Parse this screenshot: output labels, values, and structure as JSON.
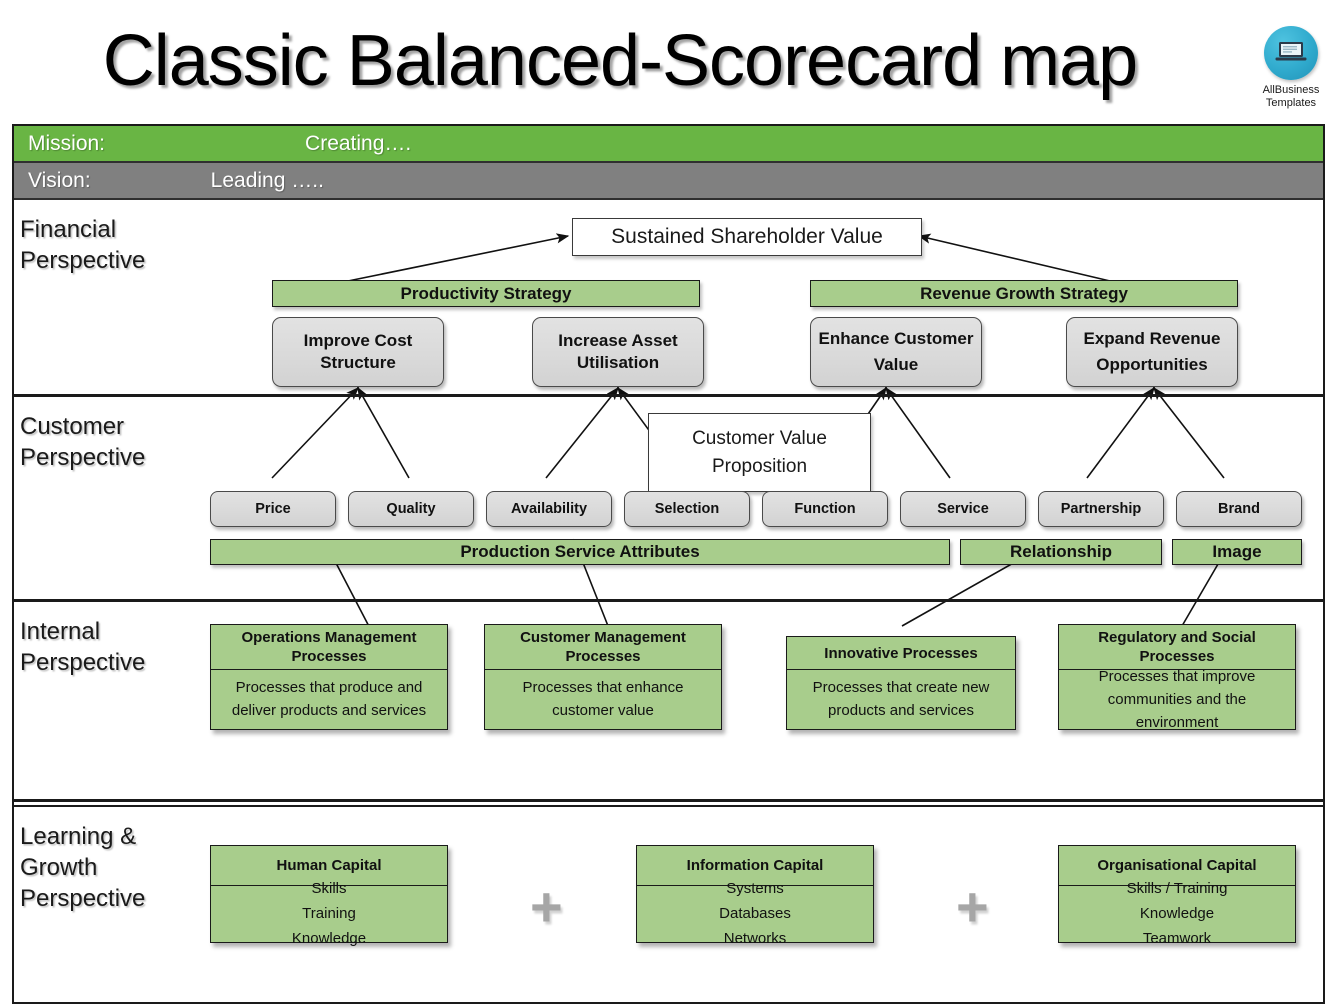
{
  "title": "Classic Balanced-Scorecard map",
  "logo": {
    "line1": "AllBusiness",
    "line2": "Templates",
    "icon": "laptop-icon"
  },
  "banners": {
    "mission": {
      "label": "Mission:",
      "value": "Creating…."
    },
    "vision": {
      "label": "Vision:",
      "value": "Leading ….."
    }
  },
  "colors": {
    "mission_green": "#69b544",
    "vision_gray": "#808080",
    "accent_green": "#a8cd8c",
    "box_gray": "#d9d9d9",
    "plus_gray": "#a6a6a6"
  },
  "perspectives": {
    "financial": {
      "label": "Financial\nPerspective"
    },
    "customer": {
      "label": "Customer\nPerspective"
    },
    "internal": {
      "label": "Internal\nPerspective"
    },
    "learning": {
      "label": "Learning &\nGrowth\nPerspective"
    }
  },
  "financial": {
    "top_objective": "Sustained Shareholder Value",
    "strategies": [
      {
        "name": "Productivity Strategy"
      },
      {
        "name": "Revenue Growth Strategy"
      }
    ],
    "objectives": [
      {
        "name": "Improve Cost Structure"
      },
      {
        "name": "Increase Asset Utilisation"
      },
      {
        "name": "Enhance Customer Value"
      },
      {
        "name": "Expand Revenue Opportunities"
      }
    ]
  },
  "customer": {
    "value_proposition": "Customer Value Proposition",
    "attributes": [
      {
        "name": "Price"
      },
      {
        "name": "Quality"
      },
      {
        "name": "Availability"
      },
      {
        "name": "Selection"
      },
      {
        "name": "Function"
      },
      {
        "name": "Service"
      },
      {
        "name": "Partnership"
      },
      {
        "name": "Brand"
      }
    ],
    "groups": [
      {
        "name": "Production Service Attributes"
      },
      {
        "name": "Relationship"
      },
      {
        "name": "Image"
      }
    ]
  },
  "internal": {
    "processes": [
      {
        "title": "Operations Management Processes",
        "description": "Processes that produce and deliver products and services"
      },
      {
        "title": "Customer Management Processes",
        "description": "Processes that enhance customer value"
      },
      {
        "title": "Innovative Processes",
        "description": "Processes that create new products and services"
      },
      {
        "title": "Regulatory and Social Processes",
        "description": "Processes that improve communities and the environment"
      }
    ]
  },
  "learning": {
    "capitals": [
      {
        "title": "Human Capital",
        "items": "Skills\nTraining\nKnowledge"
      },
      {
        "title": "Information Capital",
        "items": "Systems\nDatabases\nNetworks"
      },
      {
        "title": "Organisational Capital",
        "items": "Skills / Training\nKnowledge\nTeamwork"
      }
    ],
    "separators": [
      "+",
      "+"
    ]
  }
}
